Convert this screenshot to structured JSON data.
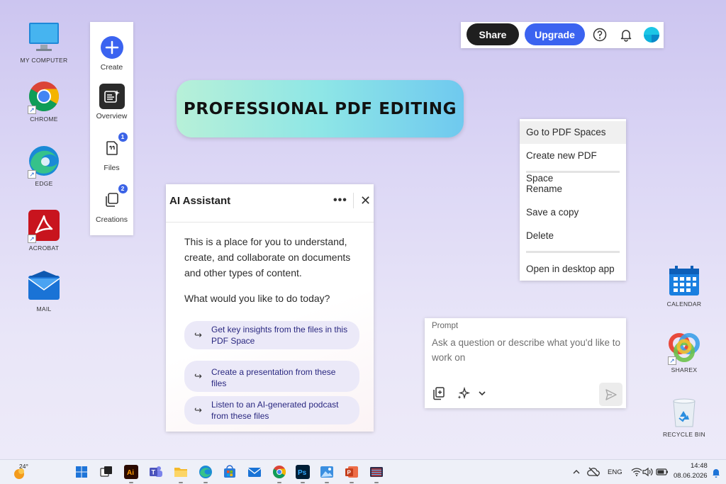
{
  "desktop": {
    "icons_left": [
      {
        "label": "MY COMPUTER",
        "icon": "monitor-icon"
      },
      {
        "label": "CHROME",
        "icon": "chrome-icon"
      },
      {
        "label": "EDGE",
        "icon": "edge-icon"
      },
      {
        "label": "ACROBAT",
        "icon": "acrobat-icon"
      },
      {
        "label": "MAIL",
        "icon": "mail-icon"
      }
    ],
    "icons_right": [
      {
        "label": "CALENDAR",
        "icon": "calendar-icon"
      },
      {
        "label": "SHAREX",
        "icon": "sharex-icon"
      },
      {
        "label": "RECYCLE BIN",
        "icon": "recycle-bin-icon"
      }
    ]
  },
  "sidebar": {
    "items": [
      {
        "label": "Create",
        "icon": "plus-icon"
      },
      {
        "label": "Overview",
        "icon": "overview-icon"
      },
      {
        "label": "Files",
        "icon": "files-icon",
        "badge": "1"
      },
      {
        "label": "Creations",
        "icon": "creations-icon",
        "badge": "2"
      }
    ]
  },
  "banner": {
    "text": "PROFESSIONAL PDF EDITING"
  },
  "topbar": {
    "share_label": "Share",
    "upgrade_label": "Upgrade",
    "icons": [
      "help-icon",
      "bell-icon",
      "avatar"
    ]
  },
  "context_menu": {
    "group1": [
      "Go to PDF Spaces",
      "Create new PDF Space"
    ],
    "group2": [
      "Rename",
      "Save a copy",
      "Delete"
    ],
    "group3": [
      "Open in desktop app"
    ]
  },
  "ai_assistant": {
    "title": "AI Assistant",
    "intro": "This is a place for you to understand, create, and collaborate on documents and other types of content.",
    "question": "What would you like to do today?",
    "suggestions": [
      "Get key insights from the files in this PDF Space",
      "Create a presentation from these files",
      "Listen to an AI-generated podcast from these files"
    ]
  },
  "prompt": {
    "label": "Prompt",
    "placeholder": "Ask a question or describe what you'd like to work on"
  },
  "taskbar": {
    "weather_temp": "24°",
    "language": "ENG",
    "time": "14:48",
    "date": "08.06.2026",
    "colors": {
      "accent": "#3b63f0",
      "share": "#1f1f1f"
    }
  }
}
